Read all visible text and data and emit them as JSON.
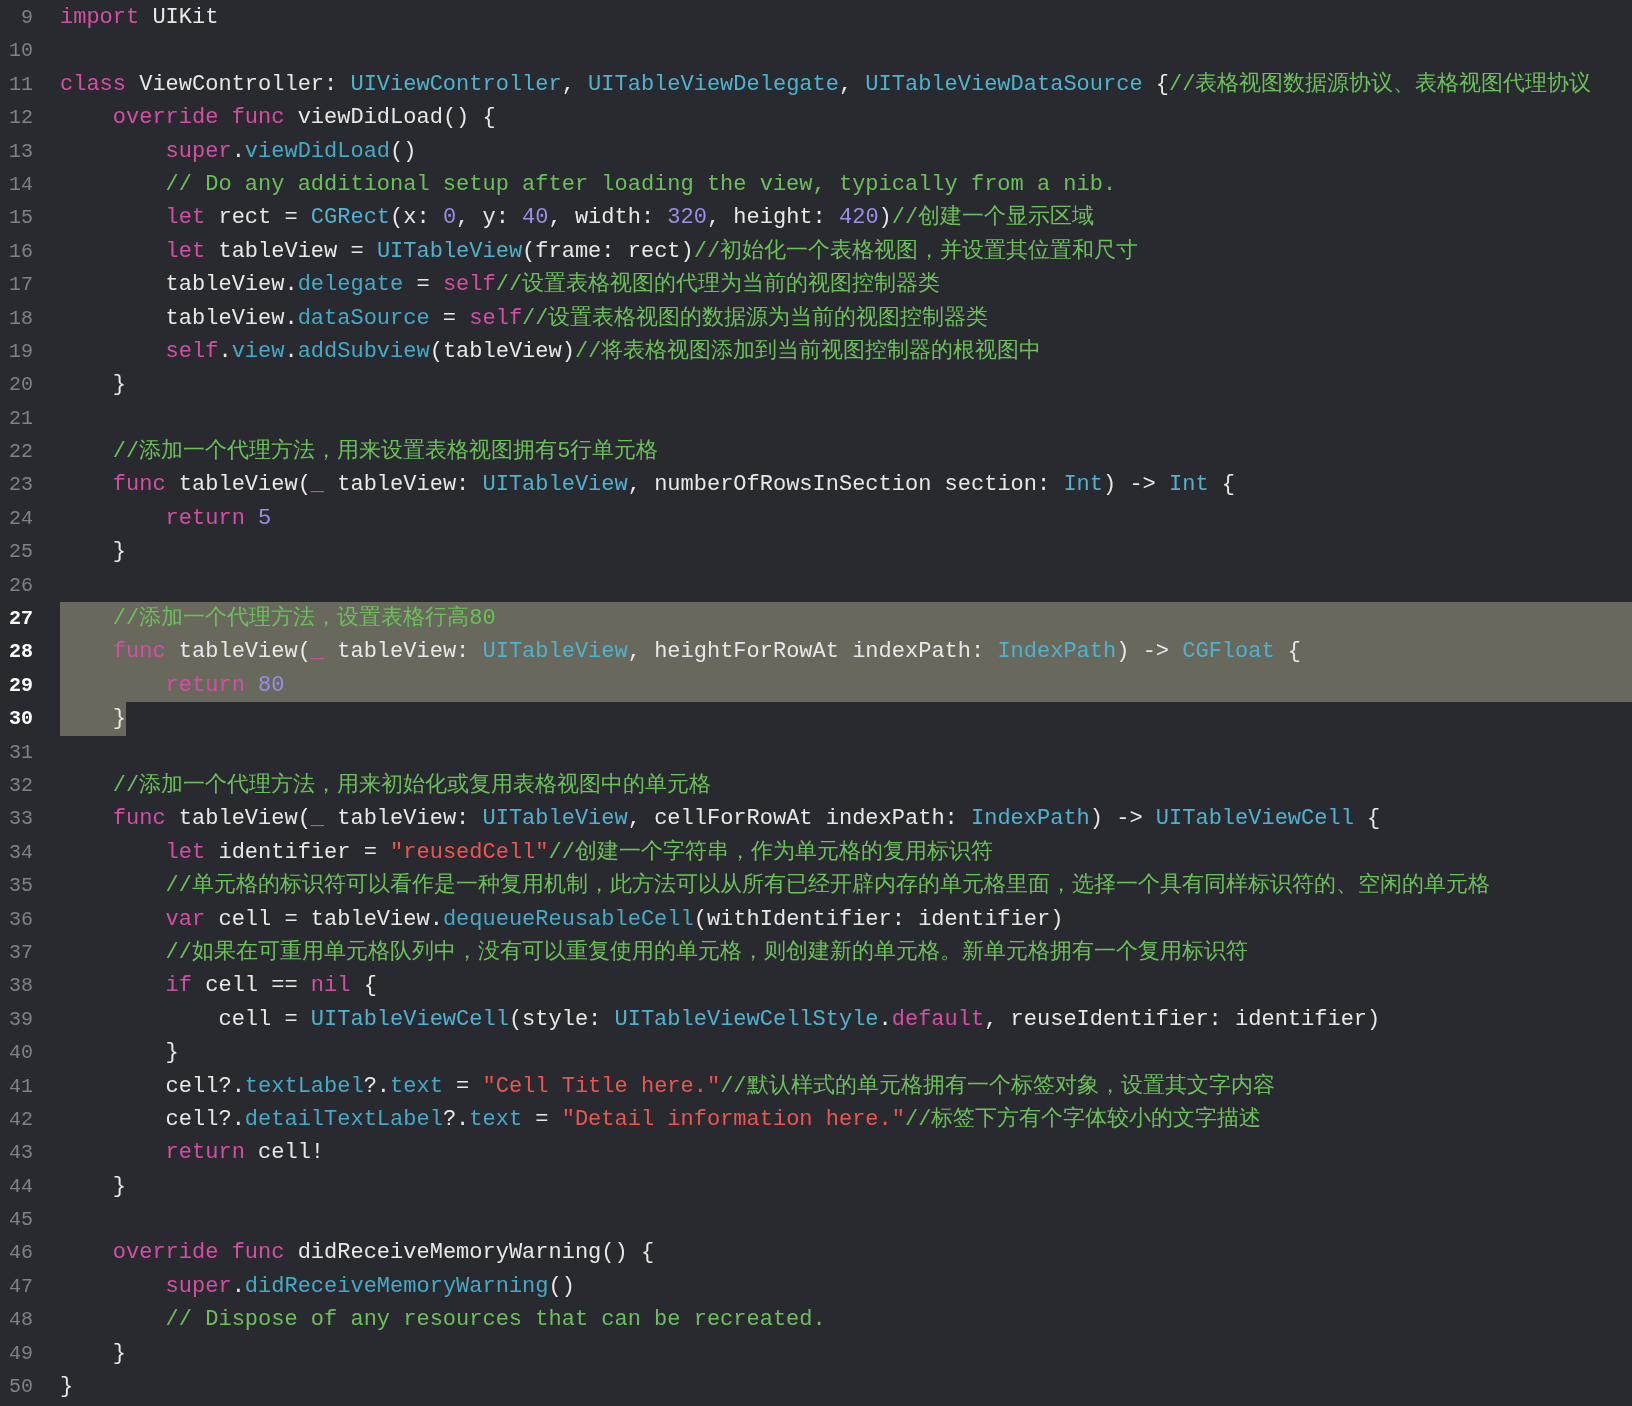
{
  "editor": {
    "lines": [
      {
        "number": "9",
        "selected": false,
        "tokens": [
          {
            "kind": "keyword",
            "text": "import"
          },
          {
            "kind": "plain",
            "text": " UIKit"
          }
        ]
      },
      {
        "number": "10",
        "selected": false
      },
      {
        "number": "11",
        "selected": false,
        "tokens": [
          {
            "kind": "keyword",
            "text": "class"
          },
          {
            "kind": "plain",
            "text": " ViewController: "
          },
          {
            "kind": "type",
            "text": "UIViewController"
          },
          {
            "kind": "plain",
            "text": ", "
          },
          {
            "kind": "type",
            "text": "UITableViewDelegate"
          },
          {
            "kind": "plain",
            "text": ", "
          },
          {
            "kind": "type",
            "text": "UITableViewDataSource"
          },
          {
            "kind": "plain",
            "text": " {"
          },
          {
            "kind": "comment",
            "text": "//表格视图数据源协议、表格视图代理协议"
          }
        ]
      },
      {
        "number": "12",
        "selected": false,
        "tokens": [
          {
            "kind": "keyword",
            "text": "    override"
          },
          {
            "kind": "keyword",
            "text": " func"
          },
          {
            "kind": "plain",
            "text": " viewDidLoad() {"
          }
        ]
      },
      {
        "number": "13",
        "selected": false,
        "tokens": [
          {
            "kind": "keyword",
            "text": "        super"
          },
          {
            "kind": "plain",
            "text": "."
          },
          {
            "kind": "member",
            "text": "viewDidLoad"
          },
          {
            "kind": "plain",
            "text": "()"
          }
        ]
      },
      {
        "number": "14",
        "selected": false,
        "tokens": [
          {
            "kind": "comment",
            "text": "        // Do any additional setup after loading the view, typically from a nib."
          }
        ]
      },
      {
        "number": "15",
        "selected": false,
        "tokens": [
          {
            "kind": "keyword",
            "text": "        let"
          },
          {
            "kind": "plain",
            "text": " rect = "
          },
          {
            "kind": "type",
            "text": "CGRect"
          },
          {
            "kind": "plain",
            "text": "(x: "
          },
          {
            "kind": "number",
            "text": "0"
          },
          {
            "kind": "plain",
            "text": ", y: "
          },
          {
            "kind": "number",
            "text": "40"
          },
          {
            "kind": "plain",
            "text": ", width: "
          },
          {
            "kind": "number",
            "text": "320"
          },
          {
            "kind": "plain",
            "text": ", height: "
          },
          {
            "kind": "number",
            "text": "420"
          },
          {
            "kind": "plain",
            "text": ")"
          },
          {
            "kind": "comment",
            "text": "//创建一个显示区域"
          }
        ]
      },
      {
        "number": "16",
        "selected": false,
        "tokens": [
          {
            "kind": "keyword",
            "text": "        let"
          },
          {
            "kind": "plain",
            "text": " tableView = "
          },
          {
            "kind": "type",
            "text": "UITableView"
          },
          {
            "kind": "plain",
            "text": "(frame: rect)"
          },
          {
            "kind": "comment",
            "text": "//初始化一个表格视图，并设置其位置和尺寸"
          }
        ]
      },
      {
        "number": "17",
        "selected": false,
        "tokens": [
          {
            "kind": "plain",
            "text": "        tableView."
          },
          {
            "kind": "member",
            "text": "delegate"
          },
          {
            "kind": "plain",
            "text": " = "
          },
          {
            "kind": "keyword",
            "text": "self"
          },
          {
            "kind": "comment",
            "text": "//设置表格视图的代理为当前的视图控制器类"
          }
        ]
      },
      {
        "number": "18",
        "selected": false,
        "tokens": [
          {
            "kind": "plain",
            "text": "        tableView."
          },
          {
            "kind": "member",
            "text": "dataSource"
          },
          {
            "kind": "plain",
            "text": " = "
          },
          {
            "kind": "keyword",
            "text": "self"
          },
          {
            "kind": "comment",
            "text": "//设置表格视图的数据源为当前的视图控制器类"
          }
        ]
      },
      {
        "number": "19",
        "selected": false,
        "tokens": [
          {
            "kind": "keyword",
            "text": "        self"
          },
          {
            "kind": "plain",
            "text": "."
          },
          {
            "kind": "member",
            "text": "view"
          },
          {
            "kind": "plain",
            "text": "."
          },
          {
            "kind": "member",
            "text": "addSubview"
          },
          {
            "kind": "plain",
            "text": "(tableView)"
          },
          {
            "kind": "comment",
            "text": "//将表格视图添加到当前视图控制器的根视图中"
          }
        ]
      },
      {
        "number": "20",
        "selected": false,
        "tokens": [
          {
            "kind": "plain",
            "text": "    }"
          }
        ]
      },
      {
        "number": "21",
        "selected": false
      },
      {
        "number": "22",
        "selected": false,
        "tokens": [
          {
            "kind": "comment",
            "text": "    //添加一个代理方法，用来设置表格视图拥有5行单元格"
          }
        ]
      },
      {
        "number": "23",
        "selected": false,
        "tokens": [
          {
            "kind": "keyword",
            "text": "    func"
          },
          {
            "kind": "plain",
            "text": " tableView("
          },
          {
            "kind": "keyword",
            "text": "_"
          },
          {
            "kind": "plain",
            "text": " tableView: "
          },
          {
            "kind": "type",
            "text": "UITableView"
          },
          {
            "kind": "plain",
            "text": ", numberOfRowsInSection section: "
          },
          {
            "kind": "type",
            "text": "Int"
          },
          {
            "kind": "plain",
            "text": ") -> "
          },
          {
            "kind": "type",
            "text": "Int"
          },
          {
            "kind": "plain",
            "text": " {"
          }
        ]
      },
      {
        "number": "24",
        "selected": false,
        "tokens": [
          {
            "kind": "keyword",
            "text": "        return"
          },
          {
            "kind": "number",
            "text": " 5"
          }
        ]
      },
      {
        "number": "25",
        "selected": false,
        "tokens": [
          {
            "kind": "plain",
            "text": "    }"
          }
        ]
      },
      {
        "number": "26",
        "selected": false
      },
      {
        "number": "27",
        "selected": true,
        "tokens": [
          {
            "kind": "comment",
            "text": "    //添加一个代理方法，设置表格行高80"
          }
        ]
      },
      {
        "number": "28",
        "selected": true,
        "tokens": [
          {
            "kind": "keyword",
            "text": "    func"
          },
          {
            "kind": "plain",
            "text": " tableView("
          },
          {
            "kind": "keyword",
            "text": "_"
          },
          {
            "kind": "plain",
            "text": " tableView: "
          },
          {
            "kind": "type",
            "text": "UITableView"
          },
          {
            "kind": "plain",
            "text": ", heightForRowAt indexPath: "
          },
          {
            "kind": "type",
            "text": "IndexPath"
          },
          {
            "kind": "plain",
            "text": ") -> "
          },
          {
            "kind": "type",
            "text": "CGFloat"
          },
          {
            "kind": "plain",
            "text": " {"
          }
        ]
      },
      {
        "number": "29",
        "selected": true,
        "tokens": [
          {
            "kind": "keyword",
            "text": "        return"
          },
          {
            "kind": "number",
            "text": " 80"
          }
        ]
      },
      {
        "number": "30",
        "selected": true,
        "tokens": [
          {
            "kind": "plain",
            "text": "    }"
          }
        ]
      },
      {
        "number": "31",
        "selected": false
      },
      {
        "number": "32",
        "selected": false,
        "tokens": [
          {
            "kind": "comment",
            "text": "    //添加一个代理方法，用来初始化或复用表格视图中的单元格"
          }
        ]
      },
      {
        "number": "33",
        "selected": false,
        "tokens": [
          {
            "kind": "keyword",
            "text": "    func"
          },
          {
            "kind": "plain",
            "text": " tableView("
          },
          {
            "kind": "keyword",
            "text": "_"
          },
          {
            "kind": "plain",
            "text": " tableView: "
          },
          {
            "kind": "type",
            "text": "UITableView"
          },
          {
            "kind": "plain",
            "text": ", cellForRowAt indexPath: "
          },
          {
            "kind": "type",
            "text": "IndexPath"
          },
          {
            "kind": "plain",
            "text": ") -> "
          },
          {
            "kind": "type",
            "text": "UITableViewCell"
          },
          {
            "kind": "plain",
            "text": " {"
          }
        ]
      },
      {
        "number": "34",
        "selected": false,
        "tokens": [
          {
            "kind": "keyword",
            "text": "        let"
          },
          {
            "kind": "plain",
            "text": " identifier = "
          },
          {
            "kind": "string",
            "text": "\"reusedCell\""
          },
          {
            "kind": "comment",
            "text": "//创建一个字符串，作为单元格的复用标识符"
          }
        ]
      },
      {
        "number": "35",
        "selected": false,
        "tokens": [
          {
            "kind": "comment",
            "text": "        //单元格的标识符可以看作是一种复用机制，此方法可以从所有已经开辟内存的单元格里面，选择一个具有同样标识符的、空闲的单元格"
          }
        ]
      },
      {
        "number": "36",
        "selected": false,
        "tokens": [
          {
            "kind": "keyword",
            "text": "        var"
          },
          {
            "kind": "plain",
            "text": " cell = tableView."
          },
          {
            "kind": "member",
            "text": "dequeueReusableCell"
          },
          {
            "kind": "plain",
            "text": "(withIdentifier: identifier)"
          }
        ]
      },
      {
        "number": "37",
        "selected": false,
        "tokens": [
          {
            "kind": "comment",
            "text": "        //如果在可重用单元格队列中，没有可以重复使用的单元格，则创建新的单元格。新单元格拥有一个复用标识符"
          }
        ]
      },
      {
        "number": "38",
        "selected": false,
        "tokens": [
          {
            "kind": "keyword",
            "text": "        if"
          },
          {
            "kind": "plain",
            "text": " cell == "
          },
          {
            "kind": "keyword",
            "text": "nil"
          },
          {
            "kind": "plain",
            "text": " {"
          }
        ]
      },
      {
        "number": "39",
        "selected": false,
        "tokens": [
          {
            "kind": "plain",
            "text": "            cell = "
          },
          {
            "kind": "type",
            "text": "UITableViewCell"
          },
          {
            "kind": "plain",
            "text": "(style: "
          },
          {
            "kind": "type",
            "text": "UITableViewCellStyle"
          },
          {
            "kind": "plain",
            "text": "."
          },
          {
            "kind": "keyword",
            "text": "default"
          },
          {
            "kind": "plain",
            "text": ", reuseIdentifier: identifier)"
          }
        ]
      },
      {
        "number": "40",
        "selected": false,
        "tokens": [
          {
            "kind": "plain",
            "text": "        }"
          }
        ]
      },
      {
        "number": "41",
        "selected": false,
        "tokens": [
          {
            "kind": "plain",
            "text": "        cell?."
          },
          {
            "kind": "member",
            "text": "textLabel"
          },
          {
            "kind": "plain",
            "text": "?."
          },
          {
            "kind": "member",
            "text": "text"
          },
          {
            "kind": "plain",
            "text": " = "
          },
          {
            "kind": "string",
            "text": "\"Cell Title here.\""
          },
          {
            "kind": "comment",
            "text": "//默认样式的单元格拥有一个标签对象，设置其文字内容"
          }
        ]
      },
      {
        "number": "42",
        "selected": false,
        "tokens": [
          {
            "kind": "plain",
            "text": "        cell?."
          },
          {
            "kind": "member",
            "text": "detailTextLabel"
          },
          {
            "kind": "plain",
            "text": "?."
          },
          {
            "kind": "member",
            "text": "text"
          },
          {
            "kind": "plain",
            "text": " = "
          },
          {
            "kind": "string",
            "text": "\"Detail information here.\""
          },
          {
            "kind": "comment",
            "text": "//标签下方有个字体较小的文字描述"
          }
        ]
      },
      {
        "number": "43",
        "selected": false,
        "tokens": [
          {
            "kind": "keyword",
            "text": "        return"
          },
          {
            "kind": "plain",
            "text": " cell!"
          }
        ]
      },
      {
        "number": "44",
        "selected": false,
        "tokens": [
          {
            "kind": "plain",
            "text": "    }"
          }
        ]
      },
      {
        "number": "45",
        "selected": false
      },
      {
        "number": "46",
        "selected": false,
        "tokens": [
          {
            "kind": "keyword",
            "text": "    override"
          },
          {
            "kind": "keyword",
            "text": " func"
          },
          {
            "kind": "plain",
            "text": " didReceiveMemoryWarning() {"
          }
        ]
      },
      {
        "number": "47",
        "selected": false,
        "tokens": [
          {
            "kind": "keyword",
            "text": "        super"
          },
          {
            "kind": "plain",
            "text": "."
          },
          {
            "kind": "member",
            "text": "didReceiveMemoryWarning"
          },
          {
            "kind": "plain",
            "text": "()"
          }
        ]
      },
      {
        "number": "48",
        "selected": false,
        "tokens": [
          {
            "kind": "comment",
            "text": "        // Dispose of any resources that can be recreated."
          }
        ]
      },
      {
        "number": "49",
        "selected": false,
        "tokens": [
          {
            "kind": "plain",
            "text": "    }"
          }
        ]
      },
      {
        "number": "50",
        "selected": false,
        "tokens": [
          {
            "kind": "plain",
            "text": "}"
          }
        ]
      }
    ]
  }
}
